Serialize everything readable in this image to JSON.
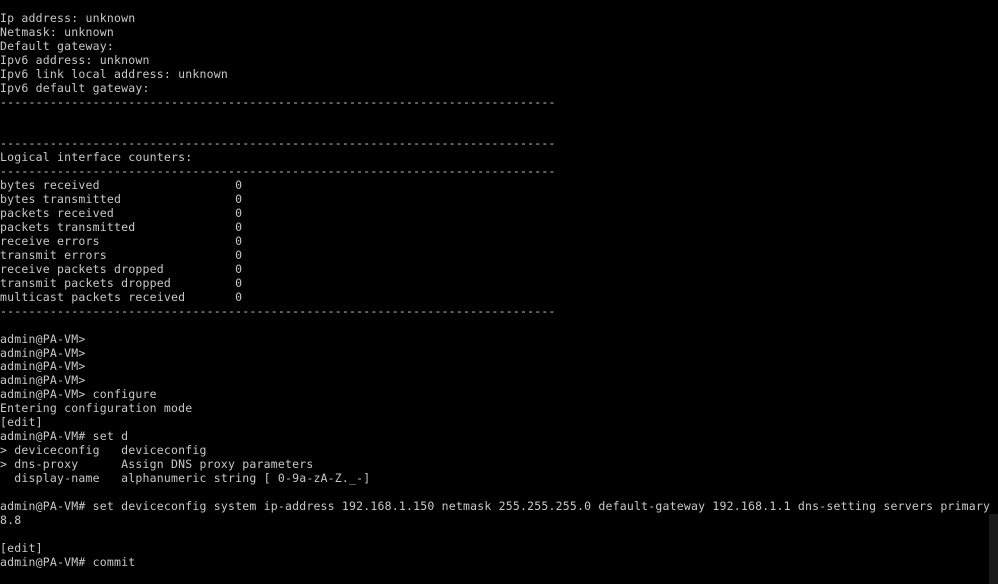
{
  "terminal": {
    "lines": [
      "Ip address: unknown",
      "Netmask: unknown",
      "Default gateway:",
      "Ipv6 address: unknown",
      "Ipv6 link local address: unknown",
      "Ipv6 default gateway:",
      "------------------------------------------------------------------------------",
      "",
      "",
      "------------------------------------------------------------------------------",
      "Logical interface counters:",
      "------------------------------------------------------------------------------",
      "bytes received                   0",
      "bytes transmitted                0",
      "packets received                 0",
      "packets transmitted              0",
      "receive errors                   0",
      "transmit errors                  0",
      "receive packets dropped          0",
      "transmit packets dropped         0",
      "multicast packets received       0",
      "------------------------------------------------------------------------------",
      "",
      "admin@PA-VM>",
      "admin@PA-VM>",
      "admin@PA-VM>",
      "admin@PA-VM>",
      "admin@PA-VM> configure",
      "Entering configuration mode",
      "[edit]",
      "admin@PA-VM# set d",
      "> deviceconfig   deviceconfig",
      "> dns-proxy      Assign DNS proxy parameters",
      "  display-name   alphanumeric string [ 0-9a-zA-Z._-]",
      "",
      "admin@PA-VM# set deviceconfig system ip-address 192.168.1.150 netmask 255.255.255.0 default-gateway 192.168.1.1 dns-setting servers primary 8.8",
      "8.8",
      "",
      "[edit]",
      "admin@PA-VM# commit"
    ]
  }
}
